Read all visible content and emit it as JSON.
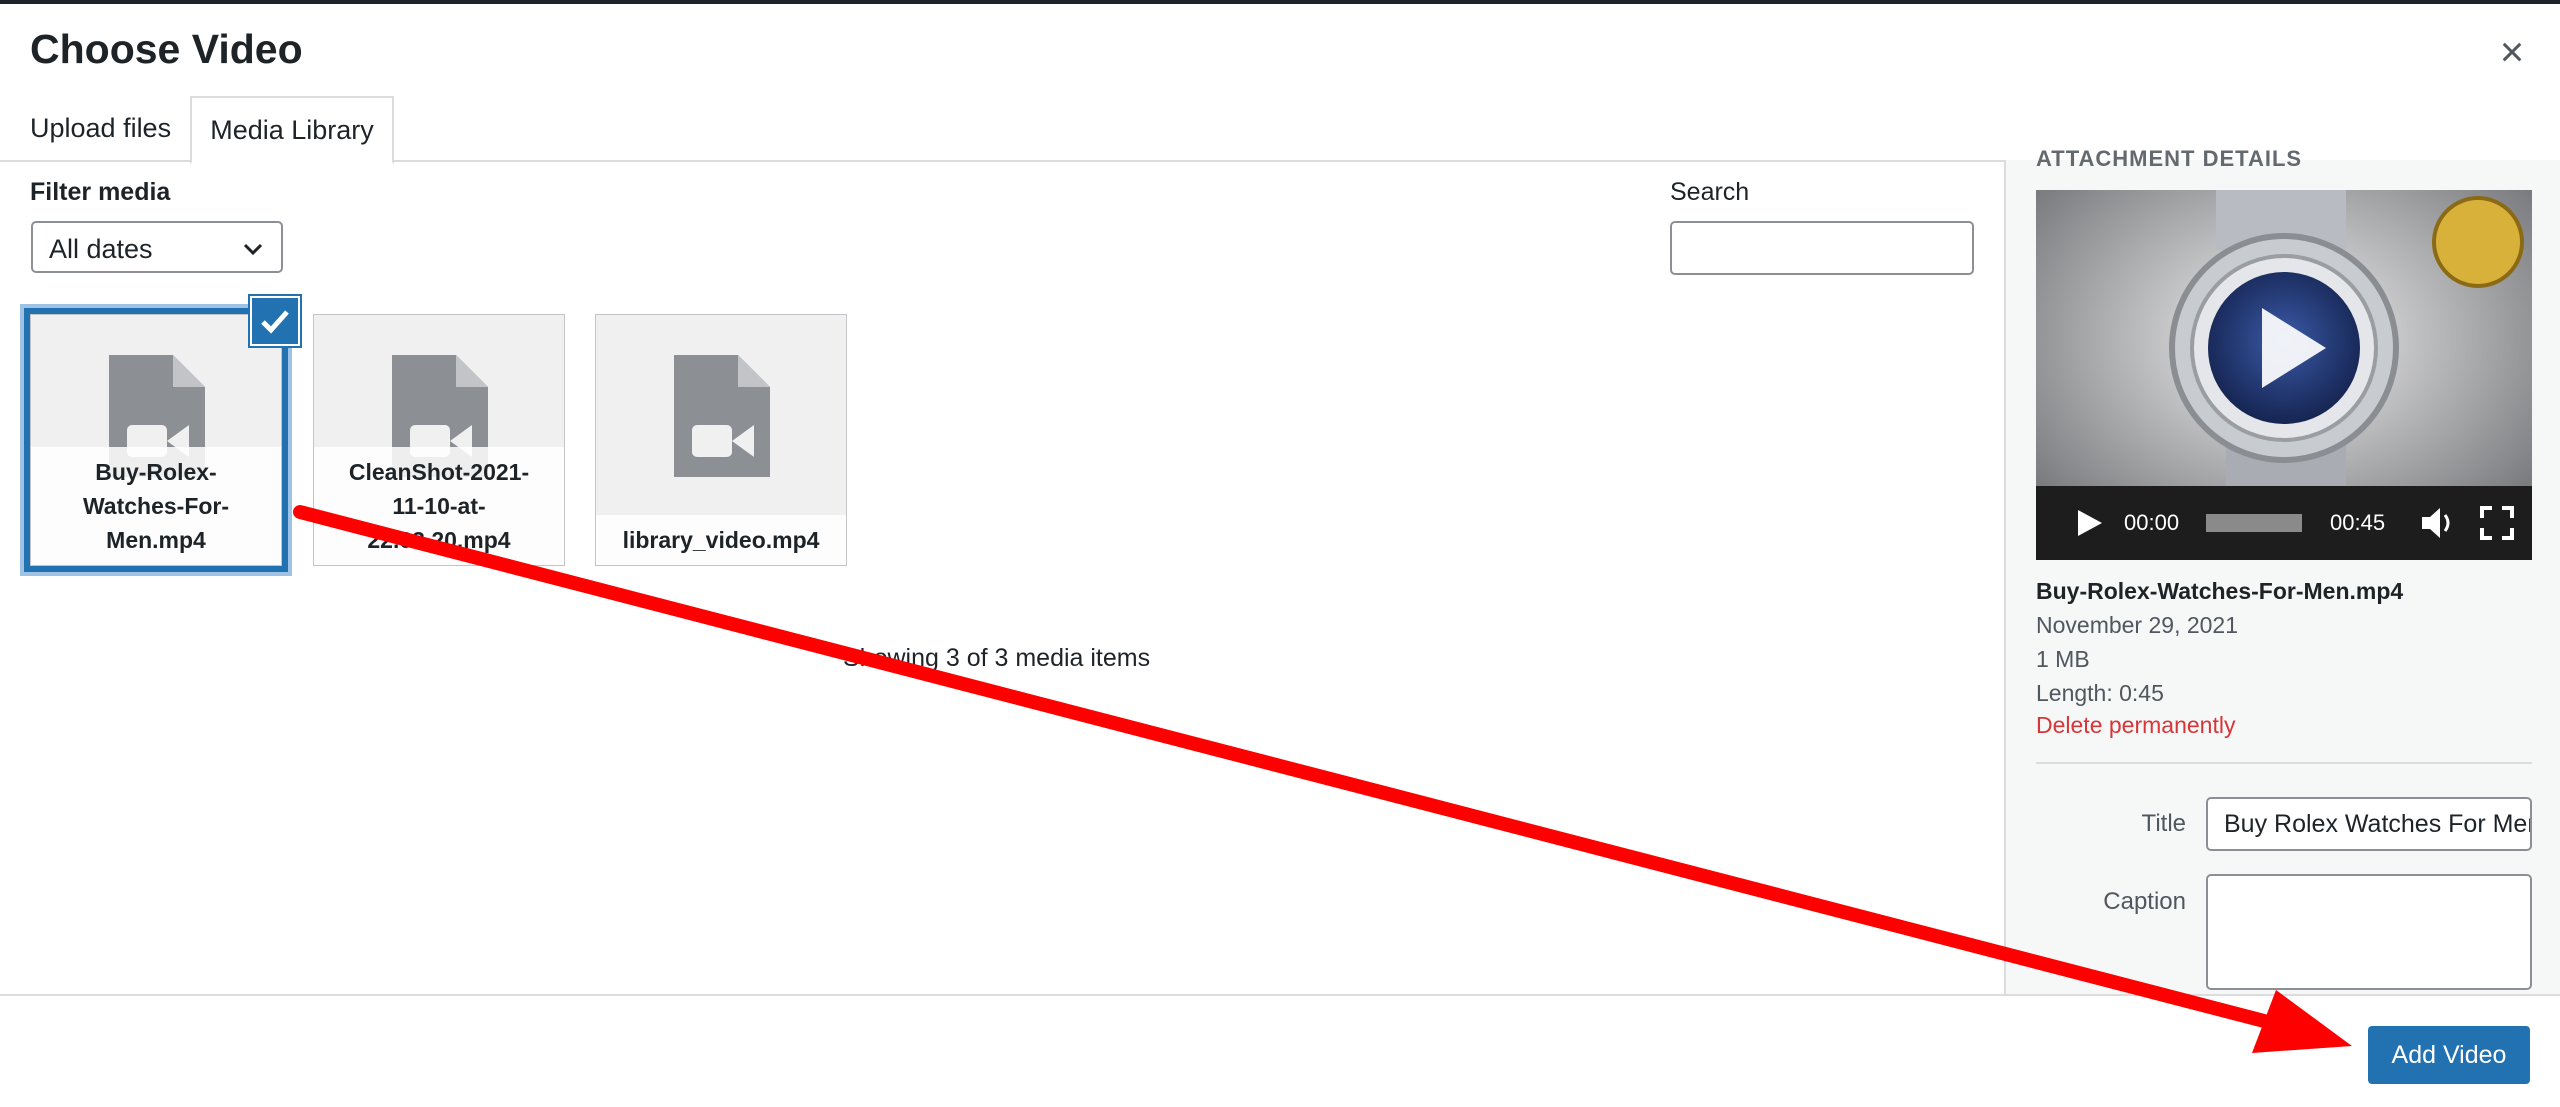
{
  "modal": {
    "title": "Choose Video",
    "close_icon": "close-icon"
  },
  "tabs": [
    {
      "label": "Upload files"
    },
    {
      "label": "Media Library",
      "active": true
    }
  ],
  "filter": {
    "label": "Filter media",
    "selected": "All dates"
  },
  "search": {
    "label": "Search",
    "value": ""
  },
  "media": [
    {
      "name": "Buy-Rolex-Watches-For-Men.mp4",
      "lines": [
        "Buy-Rolex-",
        "Watches-For-",
        "Men.mp4"
      ],
      "selected": true
    },
    {
      "name": "CleanShot-2021-11-10-at-22.03.20.mp4",
      "lines": [
        "CleanShot-2021-",
        "11-10-at-",
        "22.03.20.mp4"
      ],
      "selected": false
    },
    {
      "name": "library_video.mp4",
      "lines": [
        "library_video.mp4"
      ],
      "selected": false
    }
  ],
  "status": "Showing 3 of 3 media items",
  "attachment": {
    "heading": "ATTACHMENT DETAILS",
    "player": {
      "current_time": "00:00",
      "duration": "00:45"
    },
    "filename": "Buy-Rolex-Watches-For-Men.mp4",
    "date": "November 29, 2021",
    "size": "1 MB",
    "length": "Length: 0:45",
    "delete_label": "Delete permanently",
    "title_label": "Title",
    "title_value": "Buy Rolex Watches For Men",
    "caption_label": "Caption",
    "caption_value": ""
  },
  "footer": {
    "add_button": "Add Video"
  },
  "colors": {
    "accent": "#2271b1",
    "danger": "#d63638",
    "annotation_arrow": "#ff0000"
  }
}
